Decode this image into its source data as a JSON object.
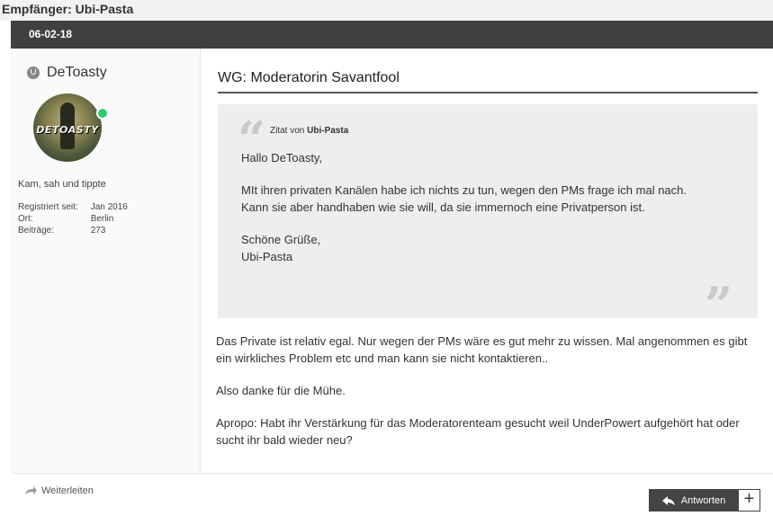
{
  "recipient_label": "Empfänger: Ubi-Pasta",
  "date": "06-02-18",
  "author": {
    "name": "DeToasty",
    "avatar_text": "DETOASTY",
    "title": "Kam, sah und tippte",
    "info": [
      {
        "key": "Registriert seit:",
        "value": "Jan 2016"
      },
      {
        "key": "Ort:",
        "value": "Berlin"
      },
      {
        "key": "Beiträge:",
        "value": "273"
      }
    ]
  },
  "post": {
    "subject": "WG: Moderatorin Savantfool",
    "quote": {
      "prefix": "Zitat von",
      "author": "Ubi-Pasta",
      "lines": [
        "Hallo DeToasty,",
        "MIt ihren privaten Kanälen habe ich nichts zu tun, wegen den PMs frage ich mal nach.\nKann sie aber handhaben wie sie will, da sie immernoch eine Privatperson ist.",
        "Schöne Grüße,\nUbi-Pasta"
      ]
    },
    "body": [
      "Das Private ist relativ egal. Nur wegen der PMs wäre es gut mehr zu wissen. Mal angenommen es gibt ein wirkliches Problem etc und man kann sie nicht kontaktieren..",
      "Also danke für die Mühe.",
      "Apropo: Habt ihr Verstärkung für das Moderatorenteam gesucht weil UnderPowert aufgehört hat oder sucht ihr bald wieder neu?"
    ]
  },
  "footer": {
    "forward_label": "Weiterleiten",
    "reply_label": "Antworten",
    "plus_label": "+"
  },
  "colors": {
    "date_bar": "#404040",
    "online": "#2ecc71",
    "reply_button": "#444444"
  }
}
